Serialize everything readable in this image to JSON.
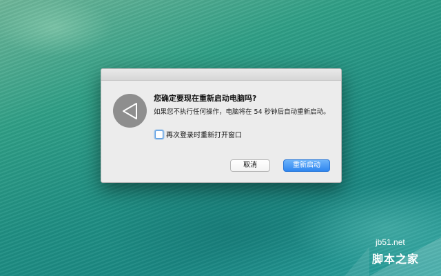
{
  "dialog": {
    "icon": "restart-triangle-icon",
    "title": "您确定要现在重新启动电脑吗?",
    "message": "如果您不执行任何操作，电脑将在 54 秒钟后自动重新启动。",
    "reopen_checkbox": {
      "label": "再次登录时重新打开窗口",
      "checked": false
    },
    "cancel_label": "取消",
    "restart_label": "重新启动",
    "accent_color": "#3a8ef0"
  },
  "watermark": {
    "domain": "jb51.net",
    "name": "脚本之家"
  }
}
